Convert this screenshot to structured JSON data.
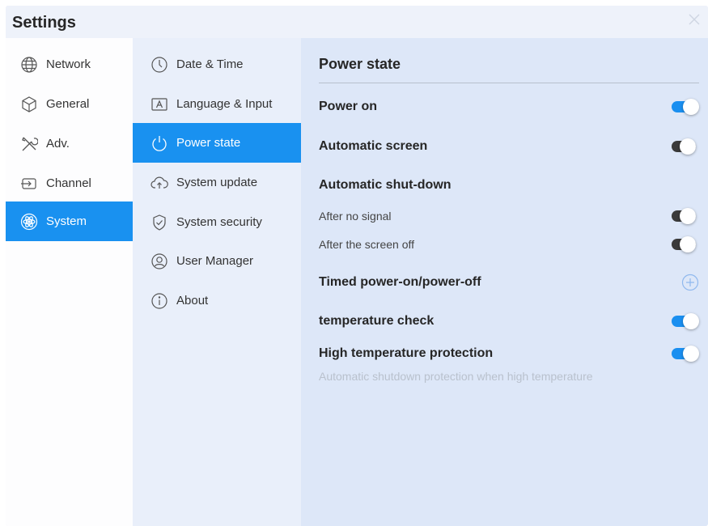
{
  "window": {
    "title": "Settings"
  },
  "categories": [
    {
      "label": "Network",
      "icon": "globe-icon",
      "active": false
    },
    {
      "label": "General",
      "icon": "cube-icon",
      "active": false
    },
    {
      "label": "Adv.",
      "icon": "tools-icon",
      "active": false
    },
    {
      "label": "Channel",
      "icon": "channel-icon",
      "active": false
    },
    {
      "label": "System",
      "icon": "atom-icon",
      "active": true
    }
  ],
  "submenu": [
    {
      "label": "Date & Time",
      "icon": "clock-icon",
      "active": false
    },
    {
      "label": "Language & Input",
      "icon": "keyboard-a-icon",
      "active": false
    },
    {
      "label": "Power state",
      "icon": "power-icon",
      "active": true
    },
    {
      "label": "System update",
      "icon": "cloud-upload-icon",
      "active": false
    },
    {
      "label": "System security",
      "icon": "shield-check-icon",
      "active": false
    },
    {
      "label": "User Manager",
      "icon": "user-icon",
      "active": false
    },
    {
      "label": "About",
      "icon": "info-icon",
      "active": false
    }
  ],
  "content": {
    "title": "Power state",
    "power_on": {
      "label": "Power on",
      "state": "on"
    },
    "automatic_screen": {
      "label": "Automatic screen",
      "state": "off"
    },
    "automatic_shutdown": {
      "label": "Automatic shut-down",
      "after_no_signal": {
        "label": "After no signal",
        "state": "off"
      },
      "after_screen_off": {
        "label": "After the screen off",
        "state": "off"
      }
    },
    "timed_power": {
      "label": "Timed power-on/power-off",
      "icon": "plus-circle-icon"
    },
    "temperature_check": {
      "label": "temperature check",
      "state": "on"
    },
    "high_temp_protection": {
      "label": "High temperature protection",
      "state": "on",
      "hint": "Automatic shutdown protection when high temperature"
    }
  },
  "colors": {
    "accent": "#1991f0",
    "toggle_on": "#1a8ff0",
    "toggle_off": "#3a3a3a",
    "content_bg": "#dde7f8"
  }
}
